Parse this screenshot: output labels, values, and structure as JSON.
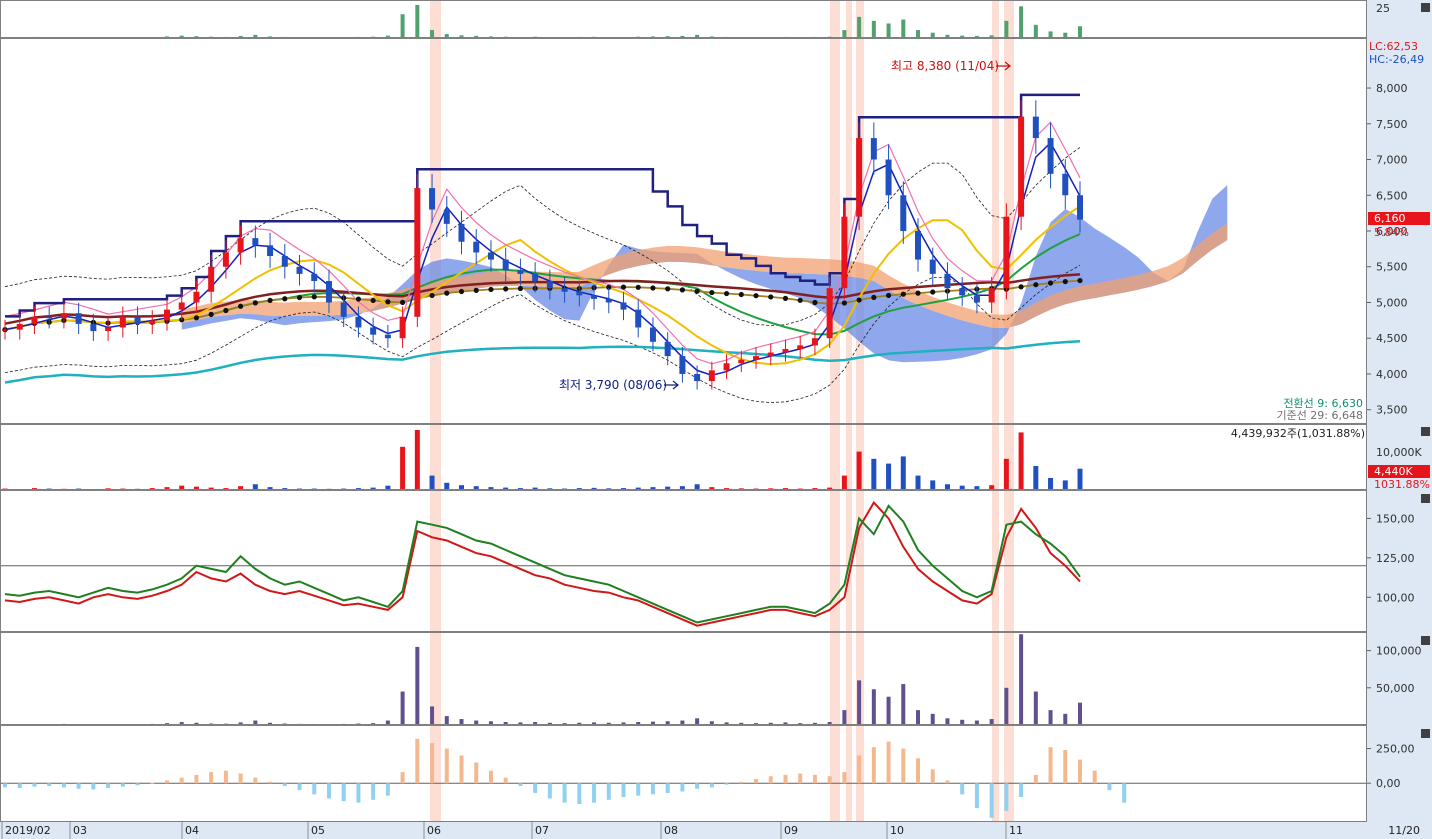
{
  "colors": {
    "up": "#e8141c",
    "down": "#2050c0",
    "axis_bg": "#dde8f4",
    "frame": "#808080",
    "highlight": "#fcd8cc",
    "cloud_blue": "#6a8ae6",
    "cloud_orange": "#f2a070"
  },
  "header_values": {
    "lc": "LC:62,53",
    "hc": "HC:-26,49",
    "price_box": "6,160",
    "price_pct": "5.84%",
    "tenkan": "전환선 9: 6,630",
    "kijun": "기준선 29: 6,648",
    "volume_info": "4,439,932주(1,031.88%)",
    "volume_box": "4,440K",
    "volume_pct": "1031.88%",
    "end_date": "11/20"
  },
  "annotations": {
    "high": "최고 8,380 (11/04)",
    "low": "최저 3,790 (08/06)"
  },
  "chart_data": [
    {
      "type": "candlestick",
      "panel": "price",
      "x_labels": [
        "2019/02",
        "03",
        "04",
        "05",
        "06",
        "07",
        "08",
        "09",
        "10",
        "11"
      ],
      "y_ticks": [
        "3,500",
        "4,000",
        "4,500",
        "5,000",
        "5,500",
        "6,000",
        "6,500",
        "7,000",
        "7,500",
        "8,000"
      ],
      "ylim": [
        3300,
        8700
      ],
      "last_price": 6160,
      "high": {
        "value": 8380,
        "date": "11/04"
      },
      "low": {
        "value": 3790,
        "date": "08/06"
      },
      "series": [
        {
          "name": "close",
          "values": [
            4620,
            4700,
            4800,
            4780,
            4850,
            4700,
            4600,
            4650,
            4800,
            4700,
            4750,
            4900,
            5000,
            5150,
            5500,
            5700,
            5900,
            5800,
            5650,
            5500,
            5400,
            5300,
            5000,
            4800,
            4650,
            4550,
            4500,
            4800,
            6600,
            6300,
            6100,
            5850,
            5700,
            5600,
            5450,
            5400,
            5300,
            5200,
            5150,
            5100,
            5050,
            5000,
            4900,
            4650,
            4450,
            4250,
            4000,
            3900,
            4050,
            4150,
            4200,
            4250,
            4300,
            4350,
            4400,
            4500,
            5200,
            6200,
            7300,
            7000,
            6500,
            6000,
            5600,
            5400,
            5200,
            5100,
            5000,
            5200,
            6200,
            7600,
            7300,
            6800,
            6500,
            6160
          ]
        }
      ]
    },
    {
      "type": "bar",
      "panel": "volume",
      "y_ticks": [
        "10,000K"
      ],
      "last_value": "4,440K",
      "values": [
        300,
        200,
        400,
        300,
        250,
        300,
        200,
        350,
        300,
        250,
        400,
        600,
        900,
        700,
        500,
        400,
        800,
        1200,
        600,
        400,
        300,
        300,
        250,
        300,
        400,
        500,
        900,
        9000,
        12500,
        3000,
        1500,
        1000,
        800,
        600,
        500,
        400,
        500,
        350,
        300,
        400,
        450,
        350,
        400,
        500,
        600,
        700,
        800,
        1200,
        600,
        400,
        350,
        300,
        350,
        400,
        300,
        400,
        500,
        3000,
        8000,
        6500,
        5500,
        7000,
        3000,
        2000,
        1200,
        900,
        800,
        1000,
        6500,
        12000,
        5000,
        2500,
        2000,
        4440
      ]
    },
    {
      "type": "line",
      "panel": "indicator",
      "y_ticks": [
        "100,00",
        "125,00",
        "150,00"
      ],
      "ylim": [
        78,
        168
      ],
      "reference_line": 120,
      "series": [
        {
          "values": [
            98,
            97,
            99,
            100,
            98,
            96,
            100,
            102,
            100,
            99,
            101,
            104,
            108,
            116,
            112,
            110,
            115,
            108,
            104,
            102,
            104,
            101,
            98,
            95,
            96,
            94,
            92,
            100,
            142,
            138,
            136,
            132,
            128,
            126,
            122,
            118,
            114,
            112,
            108,
            106,
            104,
            103,
            100,
            98,
            94,
            90,
            86,
            82,
            84,
            86,
            88,
            90,
            92,
            92,
            90,
            88,
            92,
            100,
            144,
            160,
            150,
            132,
            118,
            110,
            104,
            98,
            96,
            102,
            138,
            156,
            144,
            128,
            120,
            110
          ]
        },
        {
          "values": [
            102,
            101,
            103,
            104,
            102,
            100,
            103,
            106,
            104,
            103,
            105,
            108,
            112,
            120,
            118,
            116,
            126,
            118,
            112,
            108,
            110,
            106,
            102,
            98,
            100,
            97,
            94,
            104,
            148,
            146,
            144,
            140,
            136,
            134,
            130,
            126,
            122,
            118,
            114,
            112,
            110,
            108,
            104,
            100,
            96,
            92,
            88,
            84,
            86,
            88,
            90,
            92,
            94,
            94,
            92,
            90,
            96,
            108,
            150,
            140,
            158,
            148,
            130,
            120,
            112,
            104,
            100,
            104,
            146,
            148,
            140,
            134,
            126,
            113
          ]
        }
      ]
    },
    {
      "type": "bar",
      "panel": "indicator2",
      "y_ticks": [
        "50,000",
        "100,000"
      ],
      "ylim": [
        0,
        125000
      ],
      "values": [
        1000,
        800,
        1200,
        900,
        1500,
        1100,
        900,
        1300,
        1000,
        1200,
        1500,
        2500,
        4000,
        3000,
        2000,
        1800,
        3500,
        6000,
        3000,
        2000,
        1500,
        1400,
        1200,
        1500,
        2000,
        2500,
        6000,
        45000,
        105000,
        25000,
        12000,
        8000,
        6000,
        5000,
        4000,
        3500,
        4000,
        3000,
        2500,
        3000,
        3500,
        3000,
        3500,
        4000,
        4500,
        5000,
        6000,
        9000,
        5000,
        3500,
        3000,
        2500,
        3000,
        3500,
        2500,
        3000,
        4000,
        20000,
        60000,
        48000,
        38000,
        55000,
        20000,
        15000,
        9000,
        7000,
        6000,
        8000,
        50000,
        122000,
        45000,
        20000,
        15000,
        30000
      ]
    },
    {
      "type": "bar",
      "panel": "oscillator",
      "y_ticks": [
        "0,00",
        "250,00"
      ],
      "ylim": [
        -280,
        420
      ],
      "values": [
        -30,
        -35,
        -25,
        -20,
        -30,
        -40,
        -45,
        -35,
        -25,
        -15,
        5,
        20,
        40,
        60,
        80,
        90,
        70,
        40,
        10,
        -20,
        -50,
        -80,
        -110,
        -130,
        -140,
        -120,
        -90,
        80,
        320,
        290,
        250,
        200,
        150,
        90,
        40,
        -20,
        -70,
        -110,
        -140,
        -150,
        -140,
        -120,
        -100,
        -90,
        -80,
        -70,
        -60,
        -40,
        -30,
        -10,
        10,
        30,
        50,
        60,
        70,
        60,
        50,
        80,
        200,
        260,
        300,
        250,
        180,
        100,
        20,
        -80,
        -180,
        -250,
        -200,
        -100,
        60,
        260,
        240,
        170,
        90,
        -50,
        -140
      ]
    }
  ]
}
